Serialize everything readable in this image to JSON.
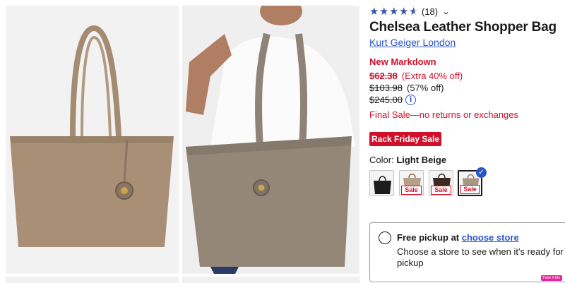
{
  "gallery": {
    "images": [
      {
        "alt": "tote-bag-product-photo"
      },
      {
        "alt": "model-wearing-tote-bag-photo"
      }
    ]
  },
  "product": {
    "rating": 4.5,
    "review_count": "(18)",
    "title": "Chelsea Leather Shopper Bag",
    "brand": "Kurt Geiger London"
  },
  "pricing": {
    "markdown_label": "New Markdown",
    "sale_price": "$62.38",
    "extra_off": "(Extra 40% off)",
    "previous_price": "$103.98",
    "previous_pct": "(57% off)",
    "original_price": "$245.00",
    "final_sale_note": "Final Sale—no returns or exchanges"
  },
  "event_badge": "Rack Friday Sale",
  "color": {
    "label": "Color:",
    "selected": "Light Beige",
    "swatches": [
      {
        "name": "black",
        "sale_tag": "",
        "color": "#1c1c1c"
      },
      {
        "name": "print",
        "sale_tag": "Sale",
        "color": "#b7a08a"
      },
      {
        "name": "dark-brown",
        "sale_tag": "Sale",
        "color": "#3a2a22"
      },
      {
        "name": "light-beige",
        "sale_tag": "Sale",
        "color": "#a89786"
      }
    ]
  },
  "pickup": {
    "title_prefix": "Free pickup at",
    "link": "choose store",
    "description": "Choose a store to see when it's ready for pickup"
  },
  "corner_tag": "Paint X Me",
  "colors": {
    "accent_red": "#d01028",
    "link_blue": "#2a55c8",
    "star_blue": "#3a55a5"
  }
}
